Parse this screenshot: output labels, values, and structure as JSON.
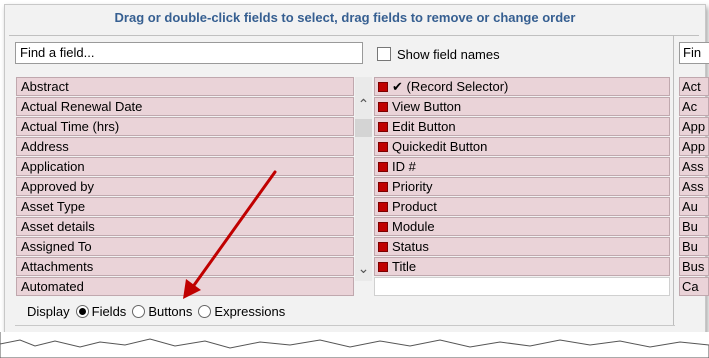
{
  "header": {
    "title": "Drag or double-click fields to select, drag fields to remove or change order"
  },
  "search": {
    "value": "Find a field...",
    "show_field_names": "Show field names",
    "right_value": "Fin"
  },
  "available_fields": [
    "Abstract",
    "Actual Renewal Date",
    "Actual Time (hrs)",
    "Address",
    "Application",
    "Approved by",
    "Asset Type",
    "Asset details",
    "Assigned To",
    "Attachments",
    "Automated"
  ],
  "selected_fields": [
    "✔ (Record Selector)",
    "View Button",
    "Edit Button",
    "Quickedit Button",
    "ID #",
    "Priority",
    "Product",
    "Module",
    "Status",
    "Title"
  ],
  "right_column": [
    "Act",
    "Ac",
    "App",
    "App",
    "Ass",
    "Ass",
    "Au",
    "Bu",
    "Bu",
    "Bus",
    "Ca"
  ],
  "display": {
    "label": "Display",
    "options": [
      "Fields",
      "Buttons",
      "Expressions"
    ],
    "selected": "Fields"
  },
  "colors": {
    "title": "#365f91",
    "row_bg": "#ead3d8",
    "marker": "#c00000",
    "arrow": "#c00000"
  }
}
